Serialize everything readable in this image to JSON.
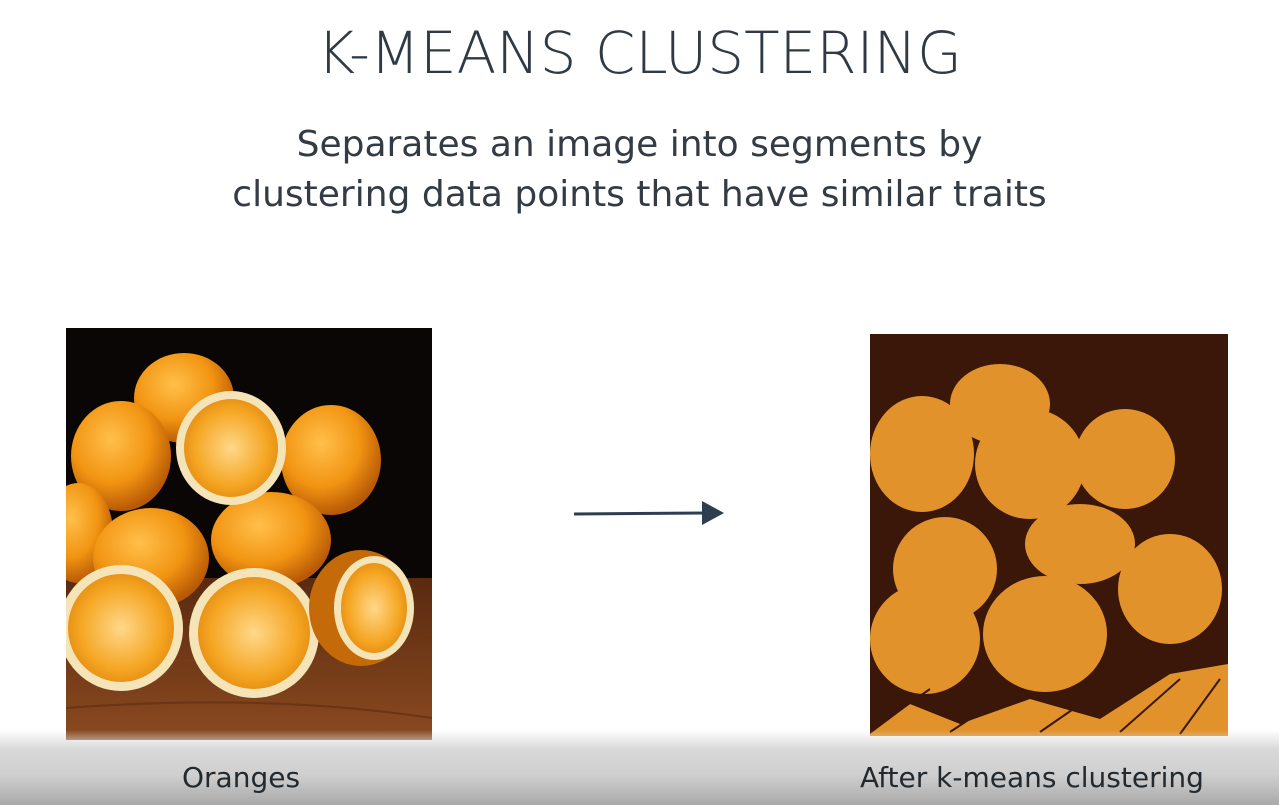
{
  "slide": {
    "title": "K-MEANS CLUSTERING",
    "subtitle_lines": [
      "Separates an image into segments by",
      "clustering data points that have similar traits"
    ],
    "left_image": {
      "caption": "Oranges"
    },
    "right_image": {
      "caption": "After k-means clustering"
    },
    "colors": {
      "text": "#2f3a44",
      "orange": "#f09a1c",
      "orange_cluster": "#e1922b",
      "dark_cluster": "#3a1708",
      "arrow": "#2c3e50"
    }
  }
}
